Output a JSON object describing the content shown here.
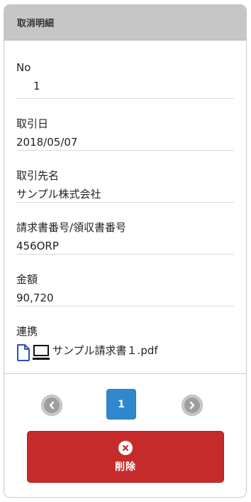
{
  "header": {
    "title": "取消明細"
  },
  "fields": [
    {
      "label": "No",
      "value": "1"
    },
    {
      "label": "取引日",
      "value": "2018/05/07"
    },
    {
      "label": "取引先名",
      "value": "サンプル株式会社"
    },
    {
      "label": "請求書番号/領収書番号",
      "value": "456ORP"
    },
    {
      "label": "金額",
      "value": "90,720"
    }
  ],
  "attachment": {
    "label": "連携",
    "file_name": "サンプル請求書１.pdf",
    "file_icon": "document-icon",
    "device_icon": "computer-icon",
    "file_icon_color": "#2b4fc7"
  },
  "pager": {
    "current_page": "1"
  },
  "actions": {
    "delete_label": "削除"
  },
  "colors": {
    "header_bg": "#c6c6c6",
    "page_active": "#2f87cf",
    "delete_bg": "#c62b2b"
  }
}
